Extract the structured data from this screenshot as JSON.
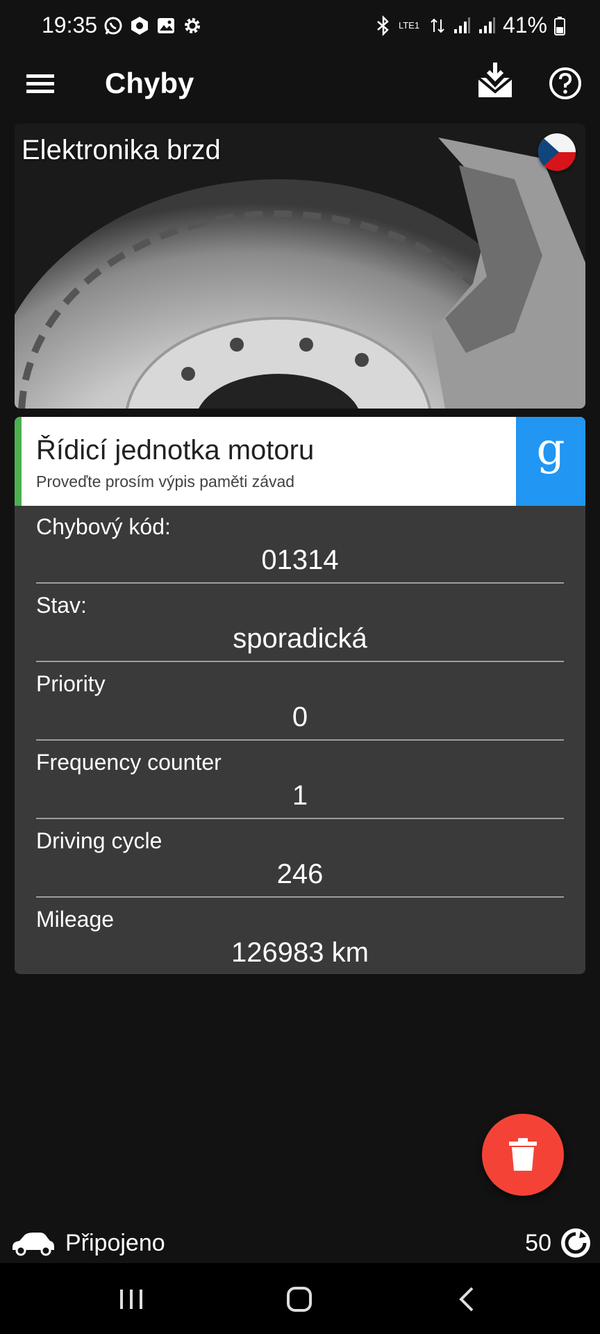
{
  "status_bar": {
    "time": "19:35",
    "network": "LTE1",
    "battery": "41%"
  },
  "app_bar": {
    "title": "Chyby"
  },
  "hero": {
    "title": "Elektronika brzd"
  },
  "ecu": {
    "title": "Řídicí jednotka motoru",
    "subtitle": "Proveďte prosím výpis paměti závad",
    "search_glyph": "g"
  },
  "details": {
    "rows": [
      {
        "label": "Chybový kód:",
        "value": "01314"
      },
      {
        "label": "Stav:",
        "value": "sporadická"
      },
      {
        "label": "Priority",
        "value": "0"
      },
      {
        "label": "Frequency counter",
        "value": "1"
      },
      {
        "label": "Driving cycle",
        "value": "246"
      },
      {
        "label": "Mileage",
        "value": "126983 km"
      }
    ]
  },
  "footer": {
    "connection_status": "Připojeno",
    "counter": "50"
  },
  "colors": {
    "background": "#121212",
    "accent_green": "#4caf50",
    "google_blue": "#2196f3",
    "fab_red": "#f44336",
    "details_bg": "#3a3a3a"
  },
  "icons": {
    "menu": "hamburger-menu-icon",
    "download": "download-inbox-icon",
    "help": "help-circle-icon",
    "flag": "czech-flag-icon",
    "delete": "trash-icon",
    "car": "car-icon",
    "counter": "refresh-circle-icon"
  }
}
